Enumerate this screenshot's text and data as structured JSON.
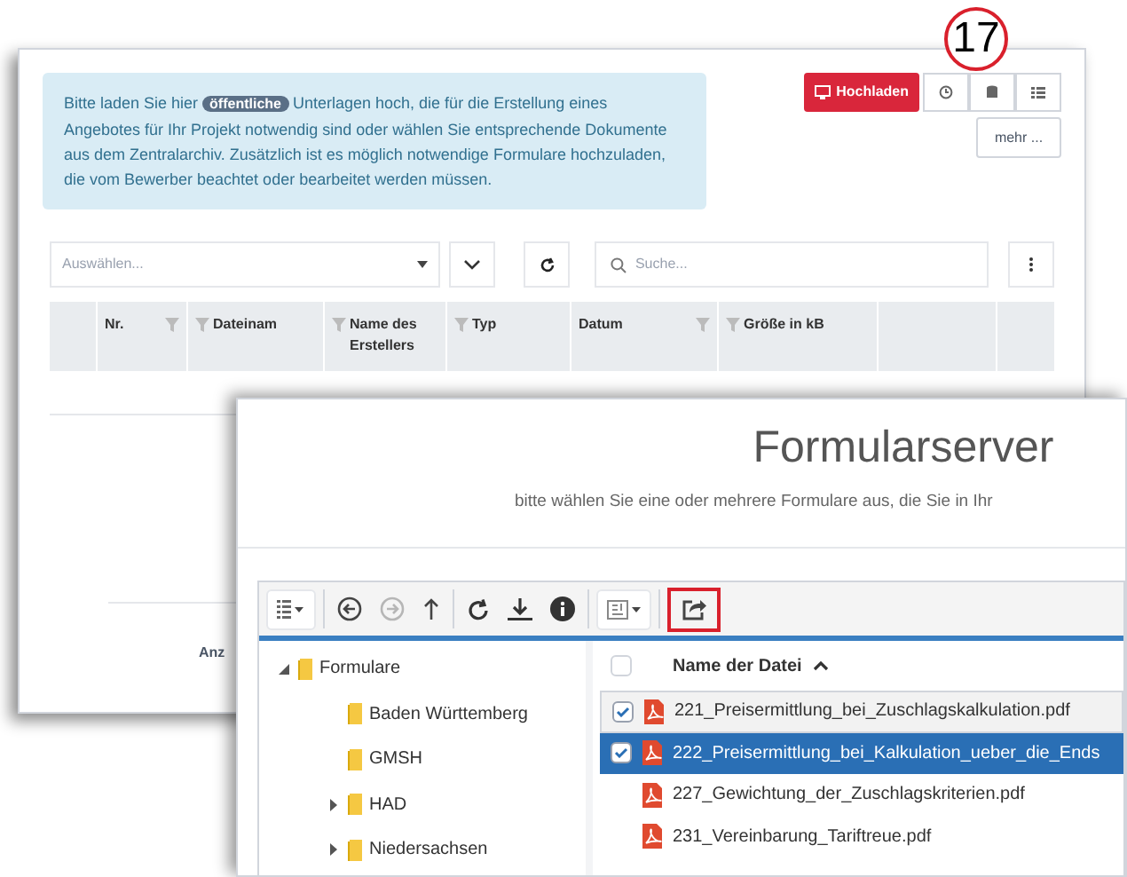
{
  "callout": {
    "label": "17"
  },
  "back_window": {
    "info": {
      "text_before": "Bitte laden Sie hier",
      "badge": "öffentliche",
      "text_after": "Unterlagen hoch, die für die Erstellung eines Angebotes für Ihr Projekt notwendig sind oder wählen Sie entsprechende Dokumente aus dem Zentralarchiv. Zusätzlich ist es möglich notwendige Formulare hochzuladen, die vom Bewerber beachtet oder bearbeitet werden müssen."
    },
    "upload_button": {
      "label": "Hochladen"
    },
    "icon_buttons": [
      {
        "kind": "clock"
      },
      {
        "kind": "database"
      },
      {
        "kind": "list"
      }
    ],
    "more_button": {
      "label": "mehr ..."
    },
    "select": {
      "placeholder": "Auswählen..."
    },
    "search": {
      "placeholder": "Suche..."
    },
    "table": {
      "columns": [
        {
          "label": "Nr.",
          "kind": "filterright"
        },
        {
          "label": "Dateinam",
          "kind": "filterleft"
        },
        {
          "label": "Name des Erstellers",
          "kind": "filterleft"
        },
        {
          "label": "Typ",
          "kind": "filterleft"
        },
        {
          "label": "Datum",
          "kind": "filterright"
        },
        {
          "label": "Größe in kB",
          "kind": "filterleft"
        }
      ]
    },
    "footer_text": "Anz"
  },
  "front_window": {
    "title": "Formularserver",
    "subtitle": "bitte wählen Sie eine oder mehrere Formulare aus, die Sie in Ihr",
    "toolbar": [
      {
        "kind": "view",
        "disabled": false,
        "highlighted": false
      },
      {
        "kind": "back",
        "disabled": false,
        "highlighted": false
      },
      {
        "kind": "forward",
        "disabled": true,
        "highlighted": false
      },
      {
        "kind": "up",
        "disabled": false,
        "highlighted": false
      },
      {
        "kind": "refresh",
        "disabled": false,
        "highlighted": false
      },
      {
        "kind": "download",
        "disabled": false,
        "highlighted": false
      },
      {
        "kind": "info",
        "disabled": false,
        "highlighted": false
      },
      {
        "kind": "sort",
        "disabled": false,
        "highlighted": false
      },
      {
        "kind": "share",
        "disabled": false,
        "highlighted": true
      }
    ],
    "tree": [
      {
        "label": "Formulare",
        "kind": "expanded",
        "children": [
          {
            "label": "Baden Württemberg",
            "kind": "leaf"
          },
          {
            "label": "GMSH",
            "kind": "leaf"
          },
          {
            "label": "HAD",
            "kind": "collapsed"
          },
          {
            "label": "Niedersachsen",
            "kind": "collapsed"
          }
        ]
      }
    ],
    "files": {
      "column": "Name der Datei",
      "all_checked": false,
      "rows": [
        {
          "name": "221_Preisermittlung_bei_Zuschlagskalkulation.pdf",
          "checked": true,
          "selected": false
        },
        {
          "name": "222_Preisermittlung_bei_Kalkulation_ueber_die_Ends",
          "checked": true,
          "selected": true
        },
        {
          "name": "227_Gewichtung_der_Zuschlagskriterien.pdf",
          "checked": false,
          "selected": false
        },
        {
          "name": "231_Vereinbarung_Tariftreue.pdf",
          "checked": false,
          "selected": false
        }
      ]
    }
  }
}
